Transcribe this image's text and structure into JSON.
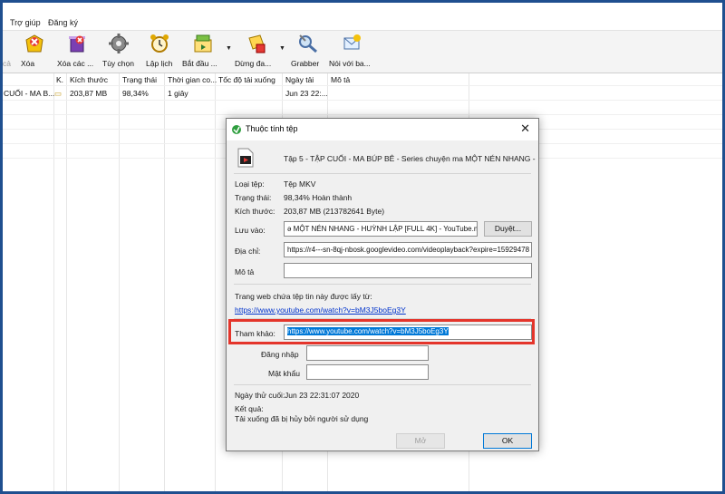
{
  "menu": [
    "Trợ giúp",
    "Đăng ký"
  ],
  "toolbar": {
    "first_stub": "cả",
    "buttons": [
      {
        "label": "Xóa",
        "icon": "delete-icon"
      },
      {
        "label": "Xóa các ...",
        "icon": "delete-completed-icon"
      },
      {
        "label": "Tùy chọn",
        "icon": "gear-icon"
      },
      {
        "label": "Lập lịch",
        "icon": "alarm-clock-icon"
      },
      {
        "label": "Bắt đầu ...",
        "icon": "start-queue-icon"
      },
      {
        "label": "Dừng đa...",
        "icon": "stop-queue-icon"
      },
      {
        "label": "Grabber",
        "icon": "grabber-icon"
      },
      {
        "label": "Nói với ba...",
        "icon": "tell-friend-icon"
      }
    ]
  },
  "list": {
    "columns": [
      "K.",
      "Kích thước",
      "Trạng thái",
      "Thời gian co...",
      "Tốc độ tải xuống",
      "Ngày tải",
      "Mô tả"
    ],
    "row": {
      "name": "CUỐI - MA B...",
      "size": "203,87  MB",
      "status": "98,34%",
      "time": "1 giây",
      "speed": "",
      "date": "Jun 23 22:...",
      "desc": ""
    }
  },
  "dialog": {
    "title": "Thuộc tính tệp",
    "file_name": "Tập 5 - TẬP CUỐI - MA BÚP BÊ - Series chuyện ma MỘT NÉN NHANG -",
    "type_label": "Loại tệp:",
    "type_value": "Tệp MKV",
    "status_label": "Trạng thái:",
    "status_value": "98,34% Hoàn thành",
    "size_label": "Kích thước:",
    "size_value": "203,87  MB (213782641 Byte)",
    "save_label": "Lưu vào:",
    "save_value": "ə MỘT NÉN NHANG - HUỲNH LẬP [FULL 4K] - YouTube.mkv",
    "browse_button": "Duyệt...",
    "address_label": "Địa chỉ:",
    "address_value": "https://r4---sn-8qj-nbosk.googlevideo.com/videoplayback?expire=15929478",
    "desc_label": "Mô tả",
    "desc_value": "",
    "source_text": "Trang web chứa tệp tin này được lấy từ:",
    "source_link": "https://www.youtube.com/watch?v=bM3J5boEg3Y",
    "ref_label": "Tham khảo:",
    "ref_value": "https://www.youtube.com/watch?v=bM3J5boEg3Y",
    "login_label": "Đăng nhập",
    "login_value": "",
    "password_label": "Mật khẩu",
    "password_value": "",
    "last_try_label": "Ngày thử cuối:",
    "last_try_value": "Jun 23 22:31:07 2020",
    "result_label": "Kết quả:",
    "result_value": "Tải xuống đã bị hủy bởi người sử dụng",
    "open_button": "Mở",
    "ok_button": "OK"
  },
  "colors": {
    "highlight": "#e4352b",
    "frame": "#1f4f8f",
    "link": "#0033cc",
    "selection": "#0078d7"
  }
}
